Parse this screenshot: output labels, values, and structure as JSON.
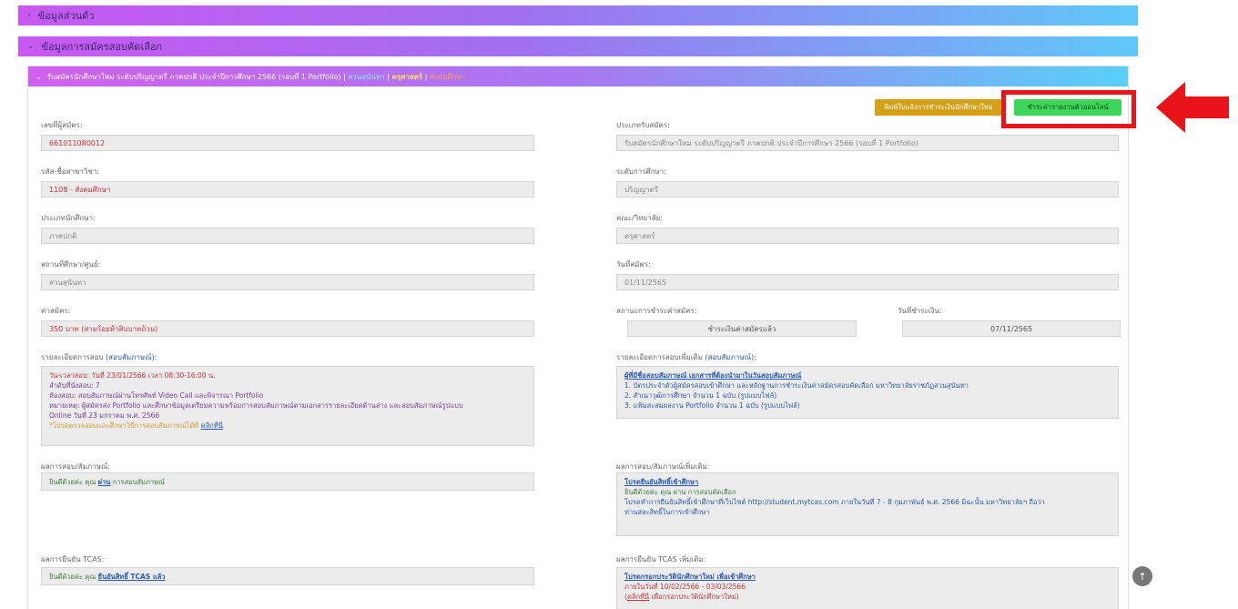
{
  "accordion": {
    "personal": "ข้อมูลส่วนตัว",
    "application": "ข้อมูลการสมัครสอบคัดเลือก"
  },
  "card": {
    "title_prefix": "รับสมัครนักศึกษาใหม่ ระดับปริญญาตรี ภาคปกติ ประจำปีการศึกษา 2566 (รอบที่ 1 Portfolio) |",
    "campus": "สวนสุนันทา",
    "faculty": "ครุศาสตร์",
    "major": "สังคมศึกษา",
    "sep": "|"
  },
  "buttons": {
    "print": "พิมพ์ใบแจ้งการชำระเงินนักศึกษาใหม่",
    "pay": "ชำระค่ารายงานตัวออนไลน์"
  },
  "left": {
    "applicant_no_label": "เลขที่ผู้สมัคร:",
    "applicant_no": "661011080012",
    "major_label": "รหัส-ชื่อสาขาวิชา:",
    "major": "1108 - สังคมศึกษา",
    "student_type_label": "ประเภทนักศึกษา:",
    "student_type": "ภาคปกติ",
    "campus_label": "สถานที่ศึกษา/ศูนย์:",
    "campus": "สวนสุนันทา",
    "fee_label": "ค่าสมัคร:",
    "fee": "350 บาท (สามร้อยห้าสิบบาทถ้วน)",
    "exam_label": "รายละเอียดการสอบ",
    "exam_label_sub": "(สอบสัมภาษณ์):",
    "exam_lines": {
      "l1": "วัน-เวลาสอบ: วันที่ 23/01/2566 เวลา 08:30-16:00 น.",
      "l2": "ลำดับที่นั่งสอบ: 7",
      "l3": "ห้องสอบ: สอบสัมภาษณ์ผ่านโทรศัพท์ Video Call และพิจารณา Portfolio",
      "l4": "หมายเหตุ: ผู้สมัครส่ง Portfolio และศึกษาข้อมูลเตรียมความพร้อมการสอบสัมภาษณ์ตามเอกสารรายละเอียดด้านล่าง และสอบสัมภาษณ์รูปแบบ",
      "l5": "Online วันที่ 23 มกราคม พ.ศ. 2566",
      "l6": "*โปรดตรวจสอบและศึกษาวิธีการสอบสัมภาษณ์ได้ที่",
      "l6_link": "คลิกที่นี่"
    },
    "result_label": "ผลการสอบ/สัมภาษณ์:",
    "result_pre": "ยินดีด้วยค่ะ คุณ",
    "result_pass": "ผ่าน",
    "result_post": "การสอบสัมภาษณ์",
    "tcas_label": "ผลการยืนยัน TCAS:",
    "tcas_pre": "ยินดีด้วยค่ะ คุณ",
    "tcas_link": "ยืนยันสิทธิ์ TCAS แล้ว"
  },
  "right": {
    "apply_type_label": "ประเภทรับสมัคร:",
    "apply_type": "รับสมัครนักศึกษาใหม่ ระดับปริญญาตรี ภาคปกติ ประจำปีการศึกษา 2566 (รอบที่ 1 Portfolio)",
    "level_label": "ระดับการศึกษา:",
    "level": "ปริญญาตรี",
    "faculty_label": "คณะ/วิทยาลัย:",
    "faculty": "ครุศาสตร์",
    "date_label": "วันที่สมัคร:",
    "date": "01/11/2565",
    "pay_status_label": "สถานะการชำระค่าสมัคร:",
    "pay_status": "ชำระเงินค่าสมัครแล้ว",
    "pay_date_label": "วันที่ชำระเงิน:",
    "pay_date": "07/11/2565",
    "extra_label": "รายละเอียดการสอบเพิ่มเติม",
    "extra_label_sub": "(สอบสัมภาษณ์):",
    "extra_lines": {
      "title": "ผู้ที่มีชื่อสอบสัมภาษณ์ เอกสารที่ต้องนำมาในวันสอบสัมภาษณ์",
      "l1": "1. บัตรประจำตัวผู้สมัครสอบเข้าศึกษา และหลักฐานการชำระเงินค่าสมัครสอบคัดเลือก มหาวิทยาลัยราชภัฏสวนสุนันทา",
      "l2": "2. สำเนาวุฒิการศึกษา จำนวน 1 ฉบับ (รูปแบบไฟล์)",
      "l3": "3. แฟ้มสะสมผลงาน Portfolio จำนวน 1 ฉบับ (รูปแบบไฟล์)"
    },
    "extra_result_label": "ผลการสอบ/สัมภาษณ์เพิ่มเติม:",
    "extra_result": {
      "title": "โปรดยืนยันสิทธิ์เข้าศึกษา",
      "l1": "ยินดีด้วยค่ะ คุณ ผ่าน การสอบคัดเลือก",
      "l2": "โปรดทำการยืนยันสิทธิ์เข้าศึกษาที่เว็บไซต์ http://student.mytcas.com ภายในวันที่ 7 - 8 กุมภาพันธ์ พ.ศ. 2566 มิฉะนั้น มหาวิทยาลัยฯ ถือว่า",
      "l3": "ท่านสละสิทธิ์ในการเข้าศึกษา"
    },
    "extra_tcas_label": "ผลการยืนยัน TCAS เพิ่มเติม:",
    "extra_tcas": {
      "title": "โปรดกรอกประวัตินักศึกษาใหม่ เพื่อเข้าศึกษา",
      "l1": "ภายในวันที่ 10/02/2566 - 03/03/2566",
      "link": "คลิกที่นี่",
      "l2": "เพื่อกรอกประวัตินักศึกษาใหม่"
    }
  },
  "icons": {
    "chevron_right": "›",
    "chevron_down": "⌄",
    "arrow_up": "↑"
  },
  "colors": {
    "highlight_box": "#e8141a",
    "pay_button": "#3cd65a",
    "print_button": "#d4a017"
  }
}
